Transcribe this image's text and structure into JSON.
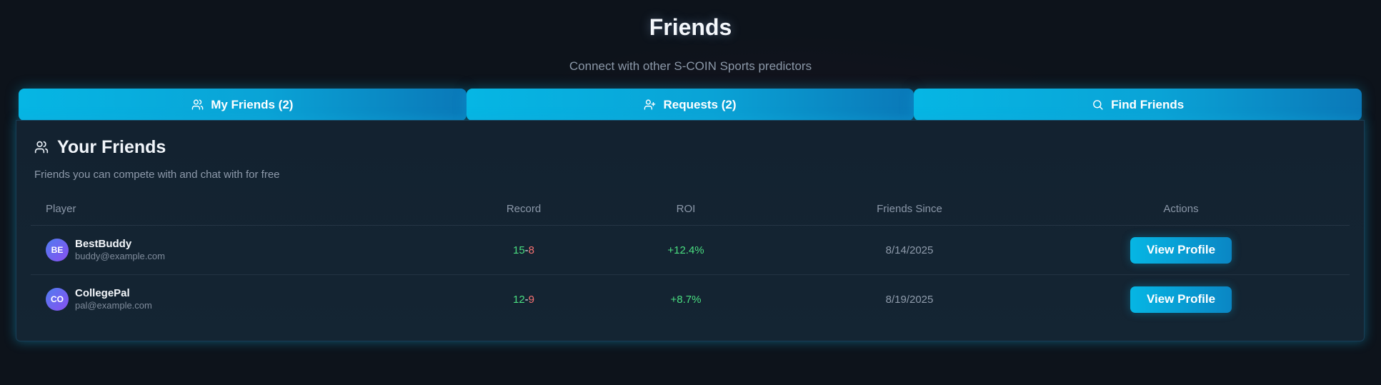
{
  "header": {
    "title": "Friends",
    "subtitle": "Connect with other S-COIN Sports predictors"
  },
  "tabs": [
    {
      "label": "My Friends (2)",
      "icon": "users-icon"
    },
    {
      "label": "Requests (2)",
      "icon": "user-plus-icon"
    },
    {
      "label": "Find Friends",
      "icon": "search-icon"
    }
  ],
  "card": {
    "title": "Your Friends",
    "description": "Friends you can compete with and chat with for free",
    "icon": "users-icon"
  },
  "table": {
    "columns": [
      "Player",
      "Record",
      "ROI",
      "Friends Since",
      "Actions"
    ],
    "rows": [
      {
        "initials": "BE",
        "name": "BestBuddy",
        "email": "buddy@example.com",
        "wins": "15",
        "losses": "8",
        "roi": "+12.4%",
        "since": "8/14/2025",
        "action": "View Profile"
      },
      {
        "initials": "CO",
        "name": "CollegePal",
        "email": "pal@example.com",
        "wins": "12",
        "losses": "9",
        "roi": "+8.7%",
        "since": "8/19/2025",
        "action": "View Profile"
      }
    ]
  },
  "colors": {
    "accent": "#06b6e4",
    "win": "#4ade80",
    "loss": "#f87171",
    "background": "#0d131b"
  }
}
